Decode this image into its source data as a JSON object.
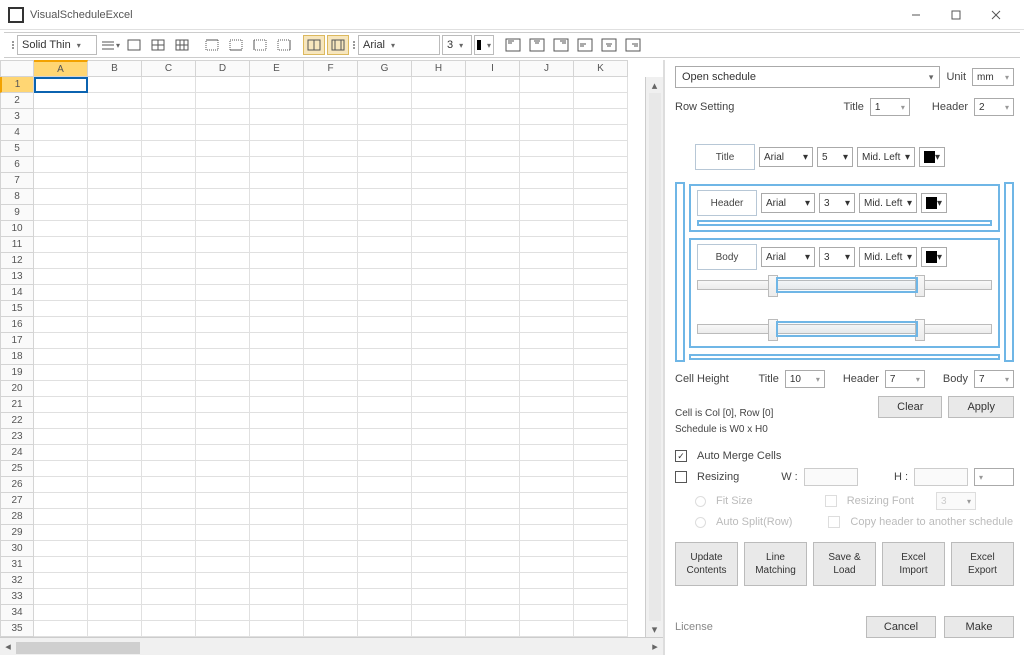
{
  "titlebar": {
    "title": "VisualScheduleExcel"
  },
  "toolbar": {
    "lineStyle": "Solid Thin",
    "fontName": "Arial",
    "fontSize": "3"
  },
  "grid": {
    "columns": [
      "A",
      "B",
      "C",
      "D",
      "E",
      "F",
      "G",
      "H",
      "I",
      "J",
      "K"
    ],
    "rowCount": 35,
    "selectedCol": "A",
    "selectedRow": 1
  },
  "right": {
    "openSchedule": "Open schedule",
    "unitLabel": "Unit",
    "unitValue": "mm",
    "rowSettingLabel": "Row Setting",
    "titleLabel": "Title",
    "titleValue": "1",
    "headerLabel": "Header",
    "headerValue": "2",
    "styles": {
      "title": {
        "label": "Title",
        "font": "Arial",
        "size": "5",
        "align": "Mid. Left"
      },
      "header": {
        "label": "Header",
        "font": "Arial",
        "size": "3",
        "align": "Mid. Left"
      },
      "body": {
        "label": "Body",
        "font": "Arial",
        "size": "3",
        "align": "Mid. Left"
      }
    },
    "cellHeight": {
      "label": "Cell Height",
      "title": "10",
      "header": "7",
      "body": "7",
      "titleLbl": "Title",
      "headerLbl": "Header",
      "bodyLbl": "Body"
    },
    "cellInfo1": "Cell is  Col [0], Row [0]",
    "cellInfo2": "Schedule is  W0 x H0",
    "clear": "Clear",
    "apply": "Apply",
    "autoMerge": "Auto Merge Cells",
    "resizing": "Resizing",
    "wLabel": "W :",
    "hLabel": "H :",
    "fitSize": "Fit Size",
    "resizingFont": "Resizing Font",
    "resizingFontVal": "3",
    "autoSplit": "Auto Split(Row)",
    "copyHeader": "Copy header to another schedule",
    "bigButtons": {
      "update": "Update\nContents",
      "lineMatching": "Line\nMatching",
      "saveLoad": "Save &\nLoad",
      "excelImport": "Excel\nImport",
      "excelExport": "Excel\nExport"
    },
    "license": "License",
    "cancel": "Cancel",
    "make": "Make"
  }
}
